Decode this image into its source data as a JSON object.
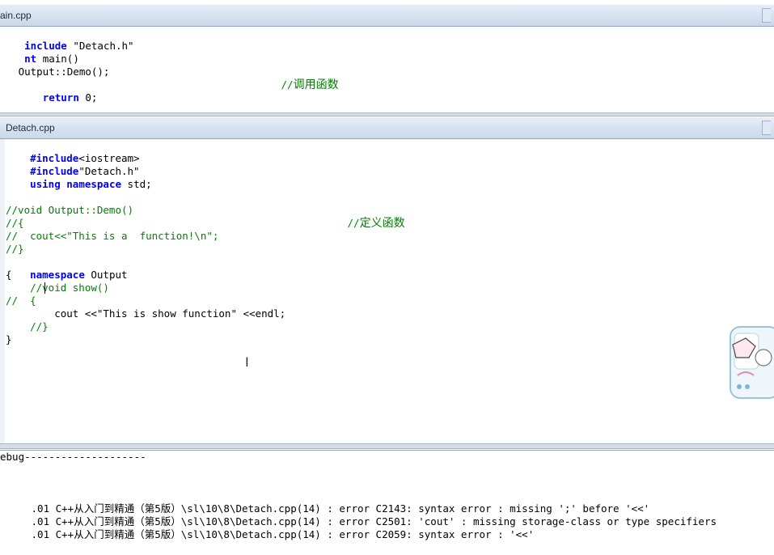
{
  "top_tab": {
    "title": "ain.cpp"
  },
  "top_code": [
    "include \"Detach.h\"",
    "nt main()",
    "",
    "   Output::Demo();",
    "   return 0;"
  ],
  "top_comment": "//调用函数",
  "bottom_tab": {
    "title": "Detach.cpp"
  },
  "code": {
    "l1_kw": "#include",
    "l1_tx": "<iostream>",
    "l2_kw": "#include",
    "l2_tx": "\"Detach.h\"",
    "l3_kw1": "using",
    "l3_kw2": "namespace",
    "l3_tx": " std;",
    "l6_cm": "//void Output::Demo()",
    "l6_zh": "//定义函数",
    "l7": "//{",
    "l8": "//  cout<<\"This is a  function!\\n\";",
    "l9": "//}",
    "l10_kw": "namespace",
    "l10_tx": " Output",
    "l11": "{",
    "l12": "    //void show()",
    "l13": "//  {",
    "l14": "        cout <<\"This is show function\" <<endl;",
    "l15": "    //}",
    "l16": "}"
  },
  "output": {
    "header": "ebug--------------------",
    "errors": [
      ".01 C++从入门到精通（第5版）\\sl\\10\\8\\Detach.cpp(14) : error C2143: syntax error : missing ';' before '<<'",
      ".01 C++从入门到精通（第5版）\\sl\\10\\8\\Detach.cpp(14) : error C2501: 'cout' : missing storage-class or type specifiers",
      ".01 C++从入门到精通（第5版）\\sl\\10\\8\\Detach.cpp(14) : error C2059: syntax error : '<<'"
    ]
  },
  "colors": {
    "keyword": "#0000ff",
    "comment": "#008000",
    "text": "#000000"
  }
}
